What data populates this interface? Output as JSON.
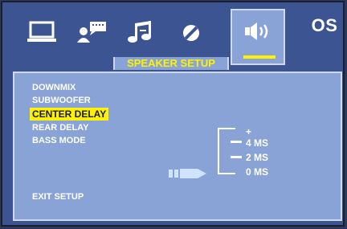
{
  "tabs": [
    {
      "name": "display",
      "icon": "monitor-icon"
    },
    {
      "name": "language",
      "icon": "person-speech-icon"
    },
    {
      "name": "audio",
      "icon": "music-note-icon"
    },
    {
      "name": "parental",
      "icon": "disc-icon"
    },
    {
      "name": "speaker",
      "icon": "speaker-icon",
      "active": true
    },
    {
      "name": "os",
      "label": "OS"
    }
  ],
  "title": "SPEAKER SETUP",
  "menu": {
    "items": [
      "DOWNMIX",
      "SUBWOOFER",
      "CENTER DELAY",
      "REAR DELAY",
      "BASS MODE"
    ],
    "selected_index": 2,
    "exit_label": "EXIT SETUP"
  },
  "options": {
    "plus": "+",
    "values": [
      "4 MS",
      "2 MS",
      "0 MS"
    ],
    "selected_value": "0 MS"
  },
  "colors": {
    "highlight": "#fff200",
    "panel": "#8aa3d6",
    "background": "#3c5592"
  }
}
